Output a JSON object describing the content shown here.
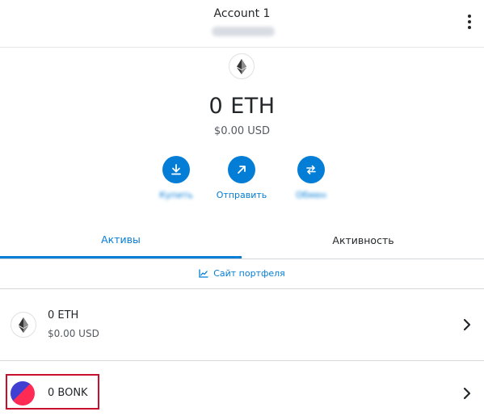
{
  "header": {
    "account_name": "Account 1"
  },
  "balance": {
    "amount": "0 ETH",
    "fiat": "$0.00 USD"
  },
  "actions": [
    {
      "label": "Купить",
      "icon": "download-icon"
    },
    {
      "label": "Отправить",
      "icon": "arrow-up-right-icon"
    },
    {
      "label": "Обмен",
      "icon": "swap-icon"
    }
  ],
  "tabs": {
    "assets": "Активы",
    "activity": "Активность"
  },
  "portfolio_link": "Сайт портфеля",
  "assets": [
    {
      "title": "0 ETH",
      "fiat": "$0.00 USD",
      "icon": "ethereum-icon"
    },
    {
      "title": "0 BONK",
      "icon": "bonk-token-icon"
    }
  ],
  "colors": {
    "accent": "#037dd6",
    "highlight_border": "#c8102e"
  }
}
